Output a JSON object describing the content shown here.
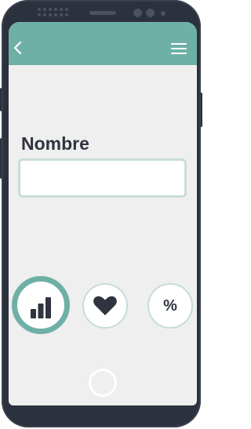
{
  "header": {
    "back_icon": "chevron-left-icon",
    "menu_icon": "hamburger-menu-icon"
  },
  "form": {
    "name_label": "Nombre",
    "name_value": "",
    "name_placeholder": ""
  },
  "actions": [
    {
      "icon": "bar-chart-icon",
      "selected": true
    },
    {
      "icon": "heart-icon",
      "selected": false
    },
    {
      "icon": "percent-icon",
      "text": "%",
      "selected": false
    }
  ],
  "device": {
    "home_button_icon": "home-button-icon"
  },
  "colors": {
    "accent": "#6fb0a6",
    "accent_light": "#c7ddd7",
    "screen_background": "#efefef",
    "device_frame": "#2b313d",
    "text_dark": "#2f3440"
  }
}
